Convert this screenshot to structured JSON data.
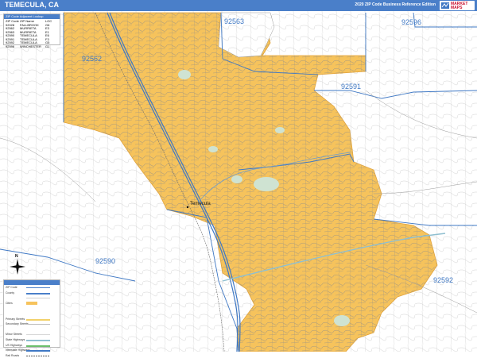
{
  "header": {
    "title": "TEMECULA, CA",
    "edition": "2020 ZIP Code Business Reference Edition",
    "logo_text": "MARKET MAPS"
  },
  "zip_index": {
    "heading": "ZIP Code Adjacent Lookup",
    "columns": [
      "ZIP Code",
      "ZIP Name",
      "LOC"
    ],
    "rows": [
      [
        "92028",
        "FALLBROOK",
        "G6"
      ],
      [
        "92562",
        "MURRIETA",
        "E3"
      ],
      [
        "92563",
        "MURRIETA",
        "E1"
      ],
      [
        "92590",
        "TEMECULA",
        "E6"
      ],
      [
        "92591",
        "TEMECULA",
        "F3"
      ],
      [
        "92592",
        "TEMECULA",
        "G5"
      ],
      [
        "92596",
        "WINCHESTER",
        "G1"
      ]
    ]
  },
  "map_labels": {
    "zips": [
      "92563",
      "92596",
      "92562",
      "92591",
      "92590",
      "92592"
    ],
    "city": "Temecula"
  },
  "legend": {
    "rows": [
      "ZIP Code",
      "County",
      "",
      "Cities",
      "",
      "",
      "Primary Streets",
      "Secondary Streets",
      "",
      "Minor Streets",
      "State Highways",
      "US Highways",
      "Interstate Highways",
      "Rail Roads"
    ]
  },
  "compass": {
    "label": "N"
  },
  "colors": {
    "title_bar": "#4a7fc9",
    "city_fill": "#f6c35c",
    "zip_label": "#3f78c4",
    "boundary": "#3f78c4",
    "street": "#9a9a9a",
    "park": "#cfe3d2"
  }
}
